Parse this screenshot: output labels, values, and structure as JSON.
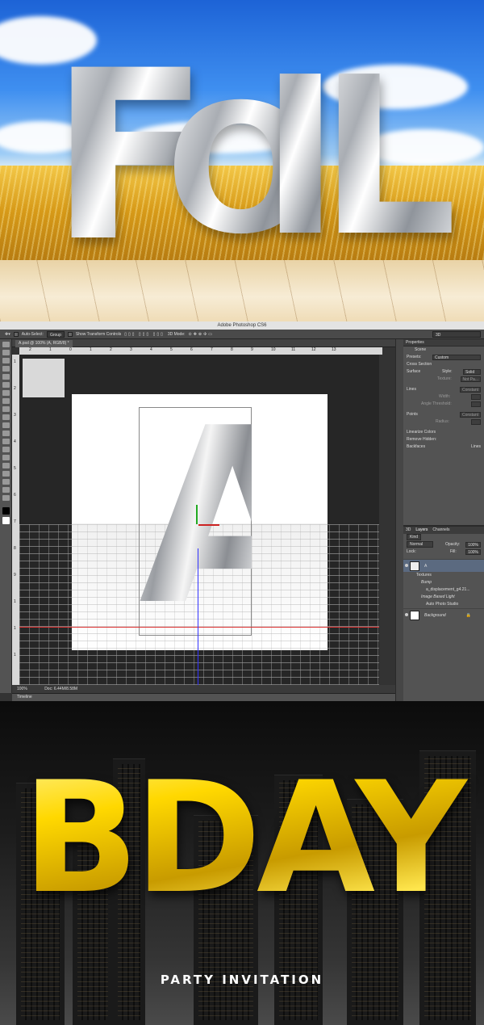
{
  "hero": {
    "word_f": "F",
    "word_o": "O",
    "word_i": "I",
    "word_l": "L"
  },
  "photoshop": {
    "app_title": "Adobe Photoshop CS6",
    "options": {
      "auto_select": "Auto-Select:",
      "group": "Group",
      "show_transform": "Show Transform Controls",
      "mode3d": "3D Mode:",
      "workspace": "3D"
    },
    "doc_tab": "A.psd @ 100% (A, RGB/8) *",
    "ruler_h": [
      "2",
      "1",
      "0",
      "1",
      "2",
      "3",
      "4",
      "5",
      "6",
      "7",
      "8",
      "9",
      "10",
      "11",
      "12",
      "13"
    ],
    "ruler_v": [
      "1",
      "2",
      "3",
      "4",
      "5",
      "6",
      "7",
      "8",
      "9",
      "1",
      "1",
      "1"
    ],
    "status": {
      "zoom": "100%",
      "doc": "Doc: 6.44M/8.58M"
    },
    "timeline": "Timeline",
    "properties": {
      "title": "Properties",
      "scene": "Scene",
      "presets_label": "Presets:",
      "presets_value": "Custom",
      "cross_section": "Cross Section",
      "surface": "Surface",
      "style_label": "Style:",
      "surface_style": "Solid",
      "texture_label": "Texture:",
      "texture_value": "Not Pa...",
      "lines": "Lines",
      "lines_style": "Constant",
      "width_label": "Width:",
      "angle_label": "Angle Threshold:",
      "points": "Points",
      "points_style": "Constant",
      "radius_label": "Radius:",
      "linearize": "Linearize Colors",
      "remove_hidden": "Remove Hidden:",
      "backfaces": "Backfaces",
      "lines_check": "Lines"
    },
    "layers": {
      "tabs": [
        "3D",
        "Layers",
        "Channels"
      ],
      "kind": "Kind",
      "blend": "Normal",
      "opacity_label": "Opacity:",
      "opacity": "100%",
      "lock_label": "Lock:",
      "fill_label": "Fill:",
      "fill": "100%",
      "layer_a": "A",
      "textures": "Textures",
      "bump": "Bump",
      "bump_file": "a_displacement_g4.21...",
      "ibl": "Image Based Light",
      "auto_photo": "Auto Photo Studio",
      "background": "Background"
    }
  },
  "bday": {
    "title": "BDAY",
    "subtitle": "PARTY INVITATION"
  }
}
